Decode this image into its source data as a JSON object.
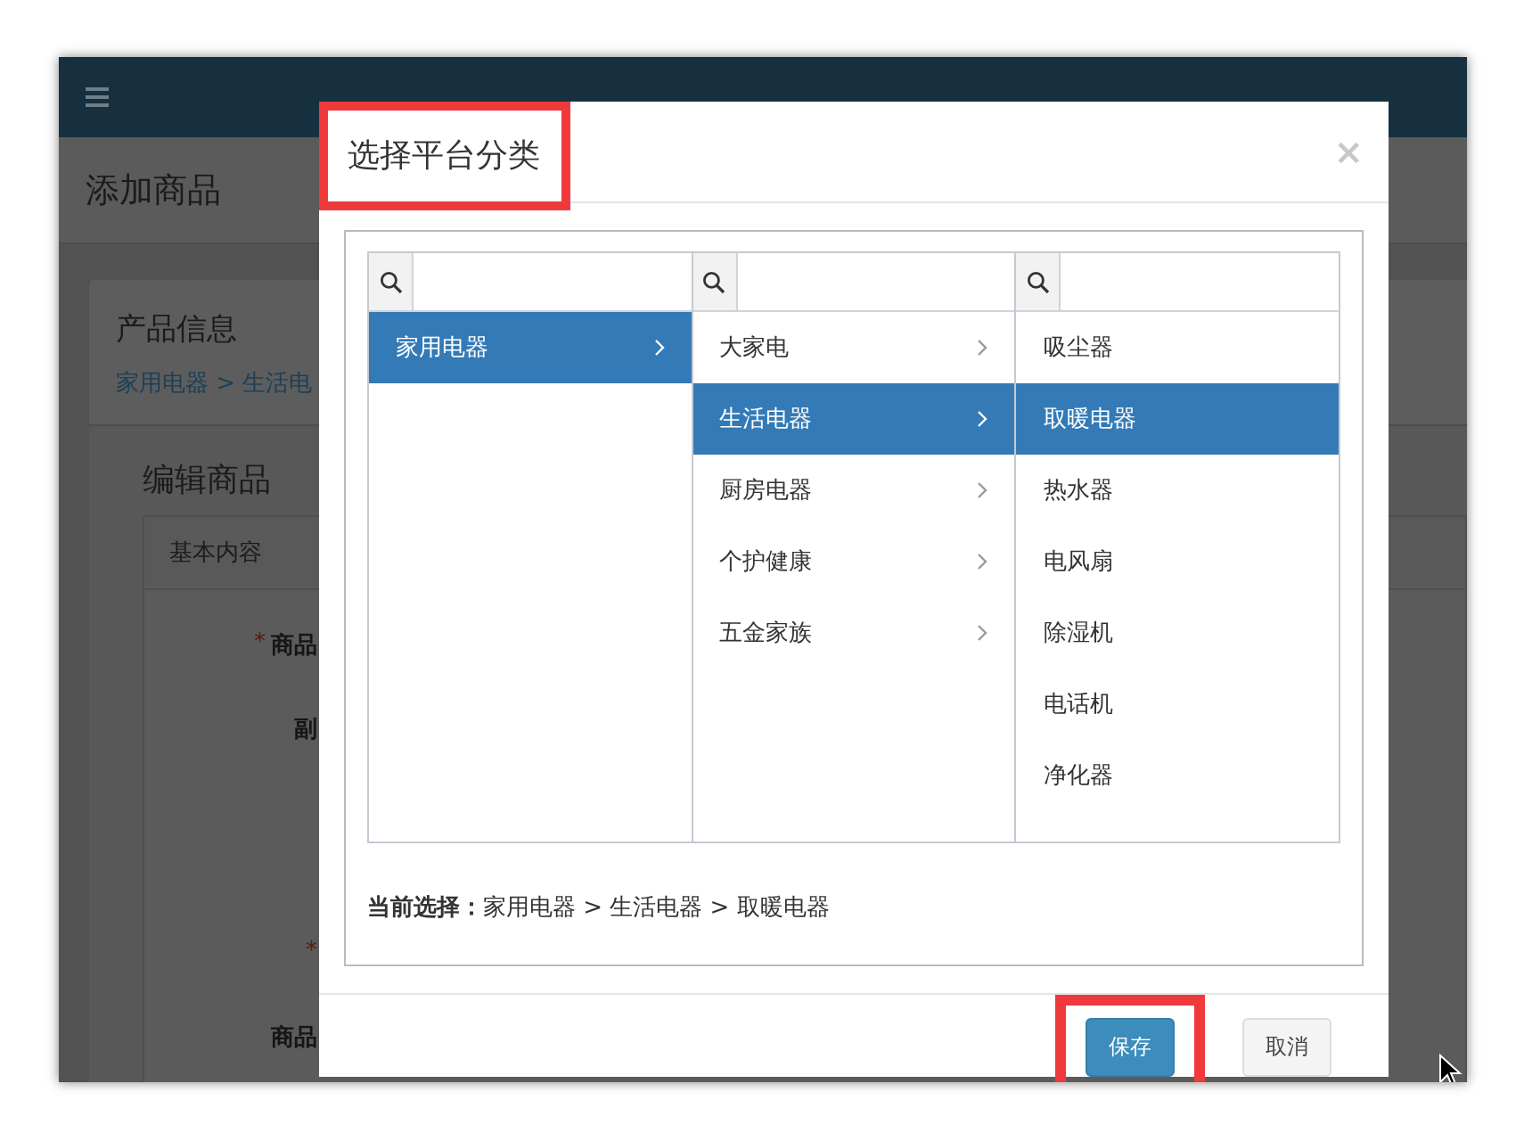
{
  "app": {
    "page_title": "添加商品",
    "card_title": "产品信息",
    "breadcrumb": "家用电器 > 生活电",
    "section_title": "编辑商品",
    "tab": "基本内容",
    "form_labels": [
      {
        "mark": "*",
        "text": "商品"
      },
      {
        "text": "副"
      },
      {
        "mark": "*"
      },
      {
        "text": "商品"
      }
    ]
  },
  "dialog": {
    "title": "选择平台分类",
    "title_highlighted": true,
    "close": "×",
    "columns": [
      {
        "items": [
          {
            "label": "家用电器",
            "selected": true,
            "has_children": true
          }
        ]
      },
      {
        "items": [
          {
            "label": "大家电",
            "selected": false,
            "has_children": true
          },
          {
            "label": "生活电器",
            "selected": true,
            "has_children": true
          },
          {
            "label": "厨房电器",
            "selected": false,
            "has_children": true
          },
          {
            "label": "个护健康",
            "selected": false,
            "has_children": true
          },
          {
            "label": "五金家族",
            "selected": false,
            "has_children": true
          }
        ]
      },
      {
        "items": [
          {
            "label": "吸尘器",
            "selected": false,
            "has_children": false
          },
          {
            "label": "取暖电器",
            "selected": true,
            "has_children": false
          },
          {
            "label": "热水器",
            "selected": false,
            "has_children": false
          },
          {
            "label": "电风扇",
            "selected": false,
            "has_children": false
          },
          {
            "label": "除湿机",
            "selected": false,
            "has_children": false
          },
          {
            "label": "电话机",
            "selected": false,
            "has_children": false
          },
          {
            "label": "净化器",
            "selected": false,
            "has_children": false
          }
        ]
      }
    ],
    "current_selection": "**当前选择：**家用电器 > 生活电器 > 取暖电器",
    "buttons": [
      {
        "label": "保存",
        "kind": "primary",
        "highlighted": true
      },
      {
        "label": "取消",
        "kind": "default",
        "highlighted": false
      }
    ]
  }
}
